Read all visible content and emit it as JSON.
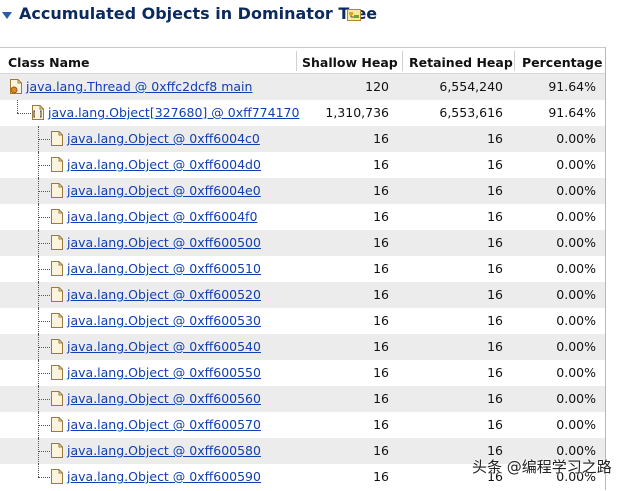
{
  "section": {
    "title": "Accumulated Objects in Dominator Tree"
  },
  "table": {
    "columns": [
      "Class Name",
      "Shallow Heap",
      "Retained Heap",
      "Percentage"
    ],
    "rows": [
      {
        "name": "java.lang.Thread @ 0xffc2dcf8 main",
        "shallow": "120",
        "retained": "6,554,240",
        "percentage": "91.64%",
        "level": 0,
        "icon": "thread-icon"
      },
      {
        "name": "java.lang.Object[327680] @ 0xff774170",
        "shallow": "1,310,736",
        "retained": "6,553,616",
        "percentage": "91.64%",
        "level": 1,
        "icon": "array-icon"
      },
      {
        "name": "java.lang.Object @ 0xff6004c0",
        "shallow": "16",
        "retained": "16",
        "percentage": "0.00%",
        "level": 2,
        "icon": "object-icon"
      },
      {
        "name": "java.lang.Object @ 0xff6004d0",
        "shallow": "16",
        "retained": "16",
        "percentage": "0.00%",
        "level": 2,
        "icon": "object-icon"
      },
      {
        "name": "java.lang.Object @ 0xff6004e0",
        "shallow": "16",
        "retained": "16",
        "percentage": "0.00%",
        "level": 2,
        "icon": "object-icon"
      },
      {
        "name": "java.lang.Object @ 0xff6004f0",
        "shallow": "16",
        "retained": "16",
        "percentage": "0.00%",
        "level": 2,
        "icon": "object-icon"
      },
      {
        "name": "java.lang.Object @ 0xff600500",
        "shallow": "16",
        "retained": "16",
        "percentage": "0.00%",
        "level": 2,
        "icon": "object-icon"
      },
      {
        "name": "java.lang.Object @ 0xff600510",
        "shallow": "16",
        "retained": "16",
        "percentage": "0.00%",
        "level": 2,
        "icon": "object-icon"
      },
      {
        "name": "java.lang.Object @ 0xff600520",
        "shallow": "16",
        "retained": "16",
        "percentage": "0.00%",
        "level": 2,
        "icon": "object-icon"
      },
      {
        "name": "java.lang.Object @ 0xff600530",
        "shallow": "16",
        "retained": "16",
        "percentage": "0.00%",
        "level": 2,
        "icon": "object-icon"
      },
      {
        "name": "java.lang.Object @ 0xff600540",
        "shallow": "16",
        "retained": "16",
        "percentage": "0.00%",
        "level": 2,
        "icon": "object-icon"
      },
      {
        "name": "java.lang.Object @ 0xff600550",
        "shallow": "16",
        "retained": "16",
        "percentage": "0.00%",
        "level": 2,
        "icon": "object-icon"
      },
      {
        "name": "java.lang.Object @ 0xff600560",
        "shallow": "16",
        "retained": "16",
        "percentage": "0.00%",
        "level": 2,
        "icon": "object-icon"
      },
      {
        "name": "java.lang.Object @ 0xff600570",
        "shallow": "16",
        "retained": "16",
        "percentage": "0.00%",
        "level": 2,
        "icon": "object-icon"
      },
      {
        "name": "java.lang.Object @ 0xff600580",
        "shallow": "16",
        "retained": "16",
        "percentage": "0.00%",
        "level": 2,
        "icon": "object-icon"
      },
      {
        "name": "java.lang.Object @ 0xff600590",
        "shallow": "16",
        "retained": "16",
        "percentage": "0.00%",
        "level": 2,
        "icon": "object-icon"
      }
    ]
  },
  "watermark": {
    "text": "头条 @编程学习之路"
  },
  "colors": {
    "link": "#1340b0",
    "title": "#0c2a5c",
    "row_alt": "#ececec"
  }
}
